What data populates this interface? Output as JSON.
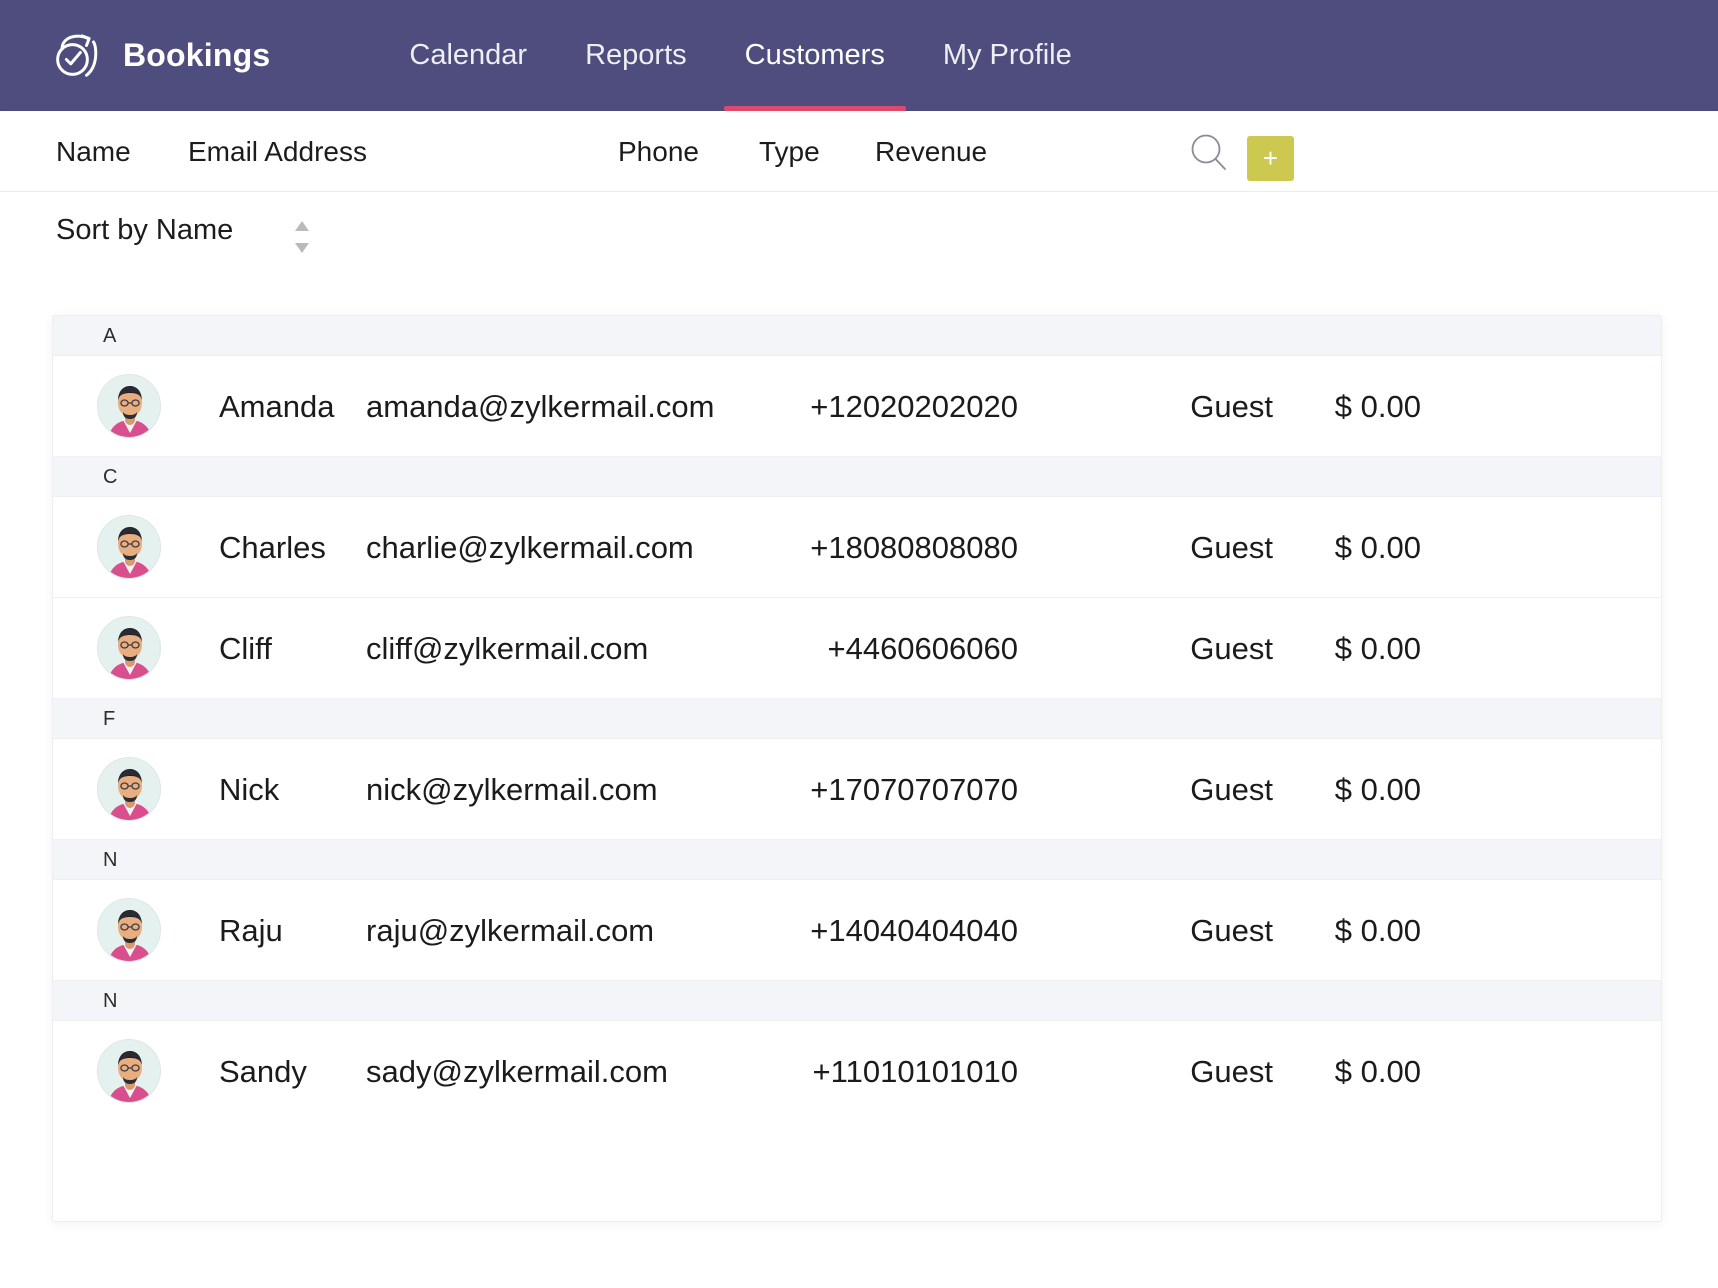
{
  "header": {
    "brand": "Bookings",
    "logo_icon": "clock-check-refresh-icon",
    "accent_color": "#e0496f",
    "bar_color": "#4e4d7d",
    "nav": [
      {
        "label": "Calendar",
        "active": false
      },
      {
        "label": "Reports",
        "active": false
      },
      {
        "label": "Customers",
        "active": true
      },
      {
        "label": "My Profile",
        "active": false
      }
    ]
  },
  "columns": {
    "name": "Name",
    "email": "Email Address",
    "phone": "Phone",
    "type": "Type",
    "revenue": "Revenue"
  },
  "actions": {
    "search_icon": "search-icon",
    "add_label": "+",
    "add_color": "#cdc950"
  },
  "sort": {
    "label": "Sort  by Name",
    "icon": "sort-updown-icon"
  },
  "groups": [
    {
      "letter": "A",
      "rows": [
        {
          "avatar": "user-avatar",
          "name": "Amanda",
          "email": "amanda@zylkermail.com",
          "phone": "+12020202020",
          "type": "Guest",
          "revenue": "$ 0.00"
        }
      ]
    },
    {
      "letter": "C",
      "rows": [
        {
          "avatar": "user-avatar",
          "name": "Charles",
          "email": "charlie@zylkermail.com",
          "phone": "+18080808080",
          "type": "Guest",
          "revenue": "$ 0.00"
        },
        {
          "avatar": "user-avatar",
          "name": "Cliff",
          "email": "cliff@zylkermail.com",
          "phone": "+4460606060",
          "type": "Guest",
          "revenue": "$ 0.00"
        }
      ]
    },
    {
      "letter": "F",
      "rows": [
        {
          "avatar": "user-avatar",
          "name": "Nick",
          "email": "nick@zylkermail.com",
          "phone": "+17070707070",
          "type": "Guest",
          "revenue": "$ 0.00"
        }
      ]
    },
    {
      "letter": "N",
      "rows": [
        {
          "avatar": "user-avatar",
          "name": "Raju",
          "email": "raju@zylkermail.com",
          "phone": "+14040404040",
          "type": "Guest",
          "revenue": "$ 0.00"
        }
      ]
    },
    {
      "letter": "N",
      "rows": [
        {
          "avatar": "user-avatar",
          "name": "Sandy",
          "email": "sady@zylkermail.com",
          "phone": "+11010101010",
          "type": "Guest",
          "revenue": "$ 0.00"
        }
      ]
    }
  ]
}
